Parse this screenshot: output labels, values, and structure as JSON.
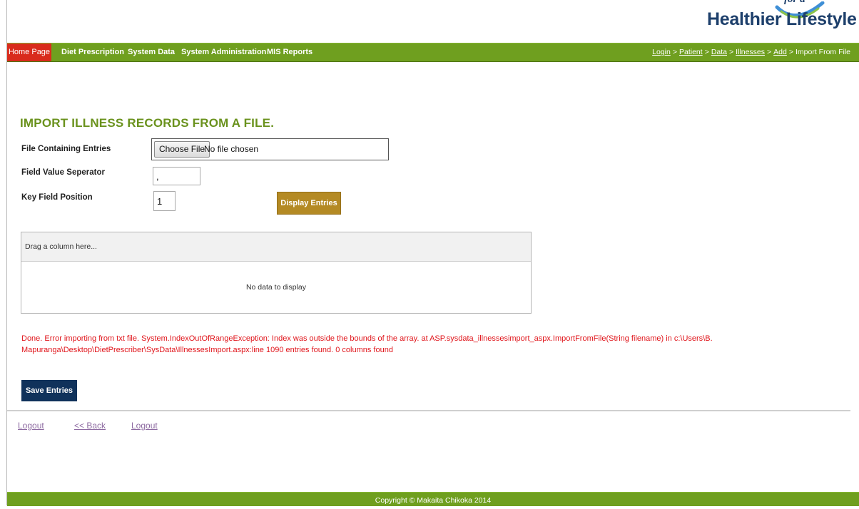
{
  "logo": {
    "tagline": "for a",
    "title": "Healthier Lifestyle"
  },
  "nav": {
    "home": "Home Page",
    "items": [
      "Diet Prescription",
      "System Data",
      "System Administration",
      "MIS Reports"
    ]
  },
  "breadcrumb": {
    "items": [
      "Login",
      "Patient",
      "Data",
      "Illnesses",
      "Add"
    ],
    "current": "Import From File",
    "separator": ">"
  },
  "page": {
    "title": "IMPORT ILLNESS RECORDS FROM A FILE."
  },
  "form": {
    "file_label": "File Containing Entries",
    "file_button": "Choose File",
    "file_status": "No file chosen",
    "separator_label": "Field Value Seperator",
    "separator_value": ",",
    "key_label": "Key Field Position",
    "key_value": "1",
    "display_button": "Display Entries"
  },
  "grid": {
    "group_panel": "Drag a column here...",
    "empty_text": "No data to display"
  },
  "error": {
    "message": "Done. Error importing from txt file. System.IndexOutOfRangeException: Index was outside the bounds of the array. at ASP.sysdata_illnessesimport_aspx.ImportFromFile(String filename) in c:\\Users\\B. Mapuranga\\Desktop\\DietPrescriber\\SysData\\IllnessesImport.aspx:line 1090 entries found. 0 columns found"
  },
  "actions": {
    "save": "Save Entries"
  },
  "footer_links": {
    "logout_1": "Logout",
    "back": "<< Back",
    "logout_2": "Logout"
  },
  "footer": {
    "copyright": "Copyright © Makaita Chikoka 2014"
  },
  "colors": {
    "nav_green": "#6f9f1f",
    "home_red": "#d92b1c",
    "title_green": "#6a921d",
    "error_red": "#e0151b",
    "save_navy": "#10325b",
    "display_gold": "#b48a24",
    "link_purple": "#8d6aa1"
  }
}
